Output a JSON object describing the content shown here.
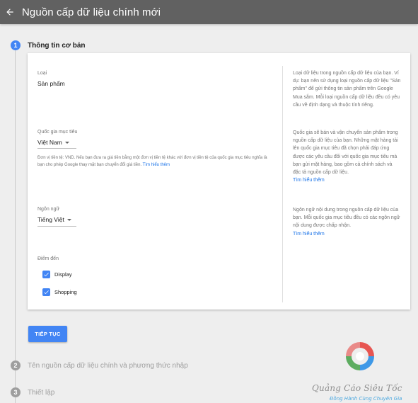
{
  "header": {
    "title": "Nguồn cấp dữ liệu chính mới",
    "back_icon": "arrow-back-icon"
  },
  "steps": [
    {
      "number": "1",
      "label": "Thông tin cơ bản",
      "state": "active"
    },
    {
      "number": "2",
      "label": "Tên nguồn cấp dữ liệu chính và phương thức nhập",
      "state": "inactive"
    },
    {
      "number": "3",
      "label": "Thiết lập",
      "state": "inactive"
    }
  ],
  "form": {
    "type": {
      "label": "Loại",
      "value": "Sản phẩm"
    },
    "country": {
      "label": "Quốc gia mục tiêu",
      "value": "Việt Nam",
      "note": "Đơn vị tiền tệ: VND. Nếu bạn đưa ra giá tiền bằng một đơn vị tiền tệ khác với đơn vị tiền tệ của quốc gia mục tiêu nghĩa là bạn cho phép Google thay mặt bạn chuyển đổi giá tiền.",
      "note_link": "Tìm hiểu thêm"
    },
    "language": {
      "label": "Ngôn ngữ",
      "value": "Tiếng Việt"
    },
    "destinations": {
      "label": "Điểm đến",
      "items": [
        {
          "label": "Display",
          "checked": true
        },
        {
          "label": "Shopping",
          "checked": true
        }
      ]
    }
  },
  "help": {
    "type": "Loại dữ liệu trong nguồn cấp dữ liệu của bạn. Ví dụ: bạn nên sử dụng loại nguồn cấp dữ liệu \"Sản phẩm\" để gửi thông tin sản phẩm trên Google Mua sắm. Mỗi loại nguồn cấp dữ liệu đều có yêu cầu về định dạng và thuộc tính riêng.",
    "country": "Quốc gia sẽ bán và vận chuyển sản phẩm trong nguồn cấp dữ liệu của bạn. Những mặt hàng tải lên quốc gia mục tiêu đã chọn phải đáp ứng được các yêu cầu đối với quốc gia mục tiêu mà bạn gửi mặt hàng, bao gồm cả chính sách và đặc tả nguồn cấp dữ liệu.",
    "country_link": "Tìm hiểu thêm",
    "language": "Ngôn ngữ nội dung trong nguồn cấp dữ liệu của bạn. Mỗi quốc gia mục tiêu đều có các ngôn ngữ nội dung được chấp nhận.",
    "language_link": "Tìm hiểu thêm"
  },
  "continue_button": "TIẾP TỤC",
  "watermark": {
    "title": "Quảng Cáo Siêu Tốc",
    "subtitle": "Đồng Hành Cùng Chuyên Gia",
    "colors": [
      "#e53935",
      "#43a047",
      "#1e88e5"
    ]
  },
  "colors": {
    "appbar": "#616161",
    "accent": "#4285f4",
    "link": "#1a73e8"
  }
}
